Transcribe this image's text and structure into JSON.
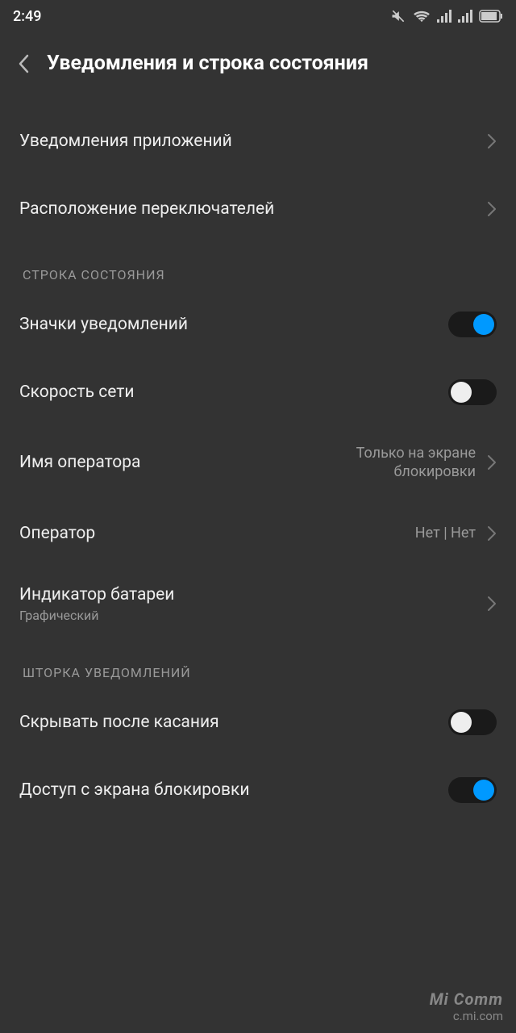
{
  "statusbar": {
    "time": "2:49"
  },
  "header": {
    "title": "Уведомления и строка состояния"
  },
  "rows": {
    "app_notifications": "Уведомления приложений",
    "toggle_positions": "Расположение переключателей"
  },
  "section1": {
    "title": "СТРОКА СОСТОЯНИЯ",
    "notification_icons": "Значки уведомлений",
    "network_speed": "Скорость сети",
    "carrier_name": "Имя оператора",
    "carrier_name_value": "Только на экране блокировки",
    "operator": "Оператор",
    "operator_value": "Нет | Нет",
    "battery_indicator": "Индикатор батареи",
    "battery_indicator_sub": "Графический"
  },
  "section2": {
    "title": "ШТОРКА УВЕДОМЛЕНИЙ",
    "hide_after_tap": "Скрывать после касания",
    "lockscreen_access": "Доступ с экрана блокировки"
  },
  "watermark": {
    "line1": "Mi Comm",
    "line2": "c.mi.com"
  }
}
